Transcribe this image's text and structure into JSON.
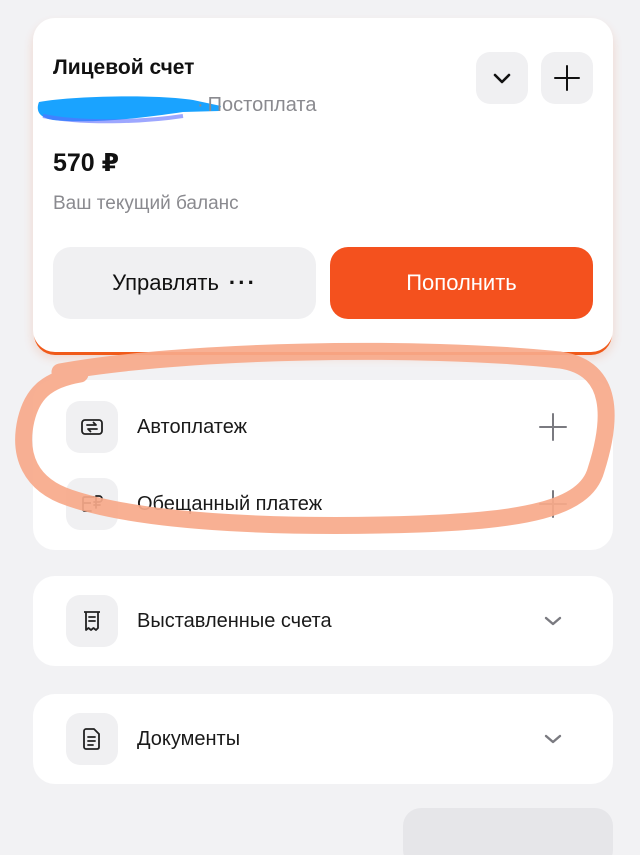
{
  "account": {
    "title": "Лицевой счет",
    "type_label": "Постоплата",
    "balance": "570 ₽",
    "balance_label": "Ваш текущий баланс",
    "manage_label": "Управлять",
    "manage_dots": "···",
    "topup_label": "Пополнить",
    "icons": {
      "expand": "chevron-down-icon",
      "add": "plus-icon"
    }
  },
  "payments": {
    "items": [
      {
        "label": "Автоплатеж",
        "icon": "autopay-cycle-icon",
        "action_icon": "plus-icon"
      },
      {
        "label": "Обещанный платеж",
        "icon": "promised-payment-icon",
        "action_icon": "plus-icon"
      }
    ]
  },
  "invoices": {
    "label": "Выставленные счета",
    "icon": "receipt-icon",
    "action_icon": "chevron-down-icon"
  },
  "documents": {
    "label": "Документы",
    "icon": "document-icon",
    "action_icon": "chevron-down-icon"
  },
  "colors": {
    "accent": "#f4511e",
    "background": "#f2f2f4",
    "card": "#ffffff",
    "muted_text": "#8a8a8f",
    "redaction": "#1aa3ff",
    "annotation": "#f7a98a"
  }
}
